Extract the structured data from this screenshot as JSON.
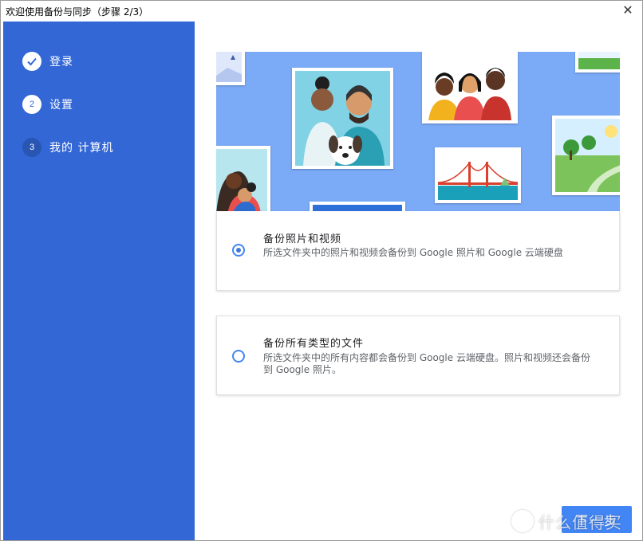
{
  "window": {
    "title": "欢迎使用备份与同步（步骤 2/3）",
    "close_glyph": "✕"
  },
  "steps": [
    {
      "number": "",
      "label": "登录",
      "state": "done",
      "icon": "check-icon"
    },
    {
      "number": "2",
      "label": "设置",
      "state": "active"
    },
    {
      "number": "3",
      "label": "我的 计算机",
      "state": "todo"
    }
  ],
  "options": [
    {
      "title": "备份照片和视频",
      "description": "所选文件夹中的照片和视频会备份到 Google 照片和 Google 云端硬盘",
      "selected": true
    },
    {
      "title": "备份所有类型的文件",
      "description": "所选文件夹中的所有内容都会备份到 Google 云端硬盘。照片和视频还会备份到 Google 照片。",
      "selected": false
    }
  ],
  "next_button": {
    "label": "下一步"
  },
  "watermark": {
    "text": "什么值得买",
    "logo": "值"
  },
  "colors": {
    "sidebar": "#3367d6",
    "illustration_bg": "#7baaf7",
    "accent": "#4285f4"
  }
}
